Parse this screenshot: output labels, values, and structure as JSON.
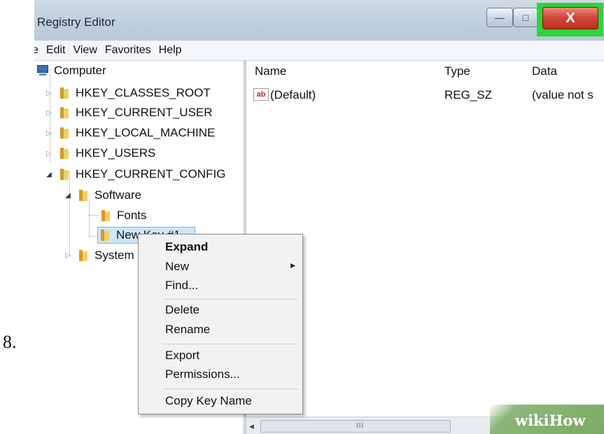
{
  "step_number": "8.",
  "window": {
    "title": "Registry Editor",
    "buttons": {
      "minimize": "—",
      "maximize": "□",
      "close": "X"
    }
  },
  "menubar": [
    "e",
    "Edit",
    "View",
    "Favorites",
    "Help"
  ],
  "tree": {
    "root": "Computer",
    "hives": [
      "HKEY_CLASSES_ROOT",
      "HKEY_CURRENT_USER",
      "HKEY_LOCAL_MACHINE",
      "HKEY_USERS",
      "HKEY_CURRENT_CONFIG"
    ],
    "software": "Software",
    "fonts": "Fonts",
    "new_key": "New Key #1",
    "system": "System"
  },
  "list": {
    "columns": [
      "Name",
      "Type",
      "Data"
    ],
    "rows": [
      {
        "name": "(Default)",
        "type": "REG_SZ",
        "data": "(value not s"
      }
    ],
    "scroll_grip": "III"
  },
  "context_menu": {
    "expand": "Expand",
    "new": "New",
    "find": "Find...",
    "delete": "Delete",
    "rename": "Rename",
    "export": "Export",
    "permissions": "Permissions...",
    "copy_key_name": "Copy Key Name"
  },
  "watermark": "wikiHow",
  "colors": {
    "close_highlight": "#2fd43a",
    "close_button": "#c9392b",
    "selection": "#cde6f7"
  }
}
